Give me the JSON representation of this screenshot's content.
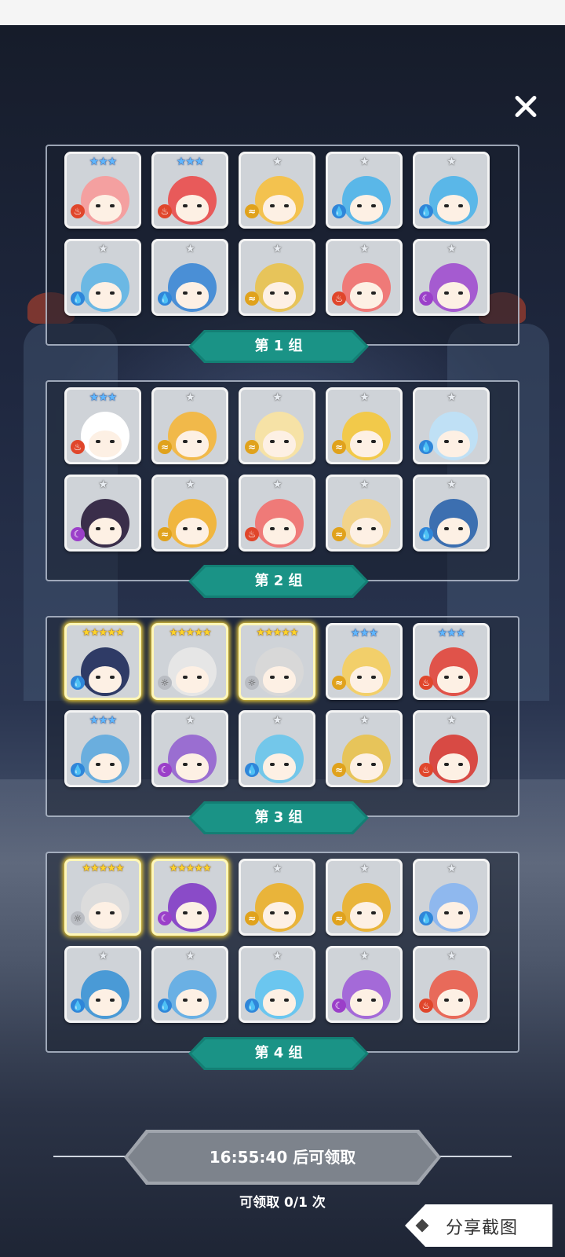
{
  "close_icon": "close-icon",
  "groups": [
    {
      "label": "第 1 组",
      "cards": [
        {
          "stars": "★★★",
          "star_tier": "blue",
          "element": "fire",
          "hair": "#f4a0a0",
          "frame": "normal"
        },
        {
          "stars": "★★★",
          "star_tier": "blue",
          "element": "fire",
          "hair": "#e85a5a",
          "frame": "normal"
        },
        {
          "stars": "★",
          "star_tier": "silver",
          "element": "wind",
          "hair": "#f3c24f",
          "frame": "normal"
        },
        {
          "stars": "★",
          "star_tier": "silver",
          "element": "water",
          "hair": "#5ab7e8",
          "frame": "normal"
        },
        {
          "stars": "★",
          "star_tier": "silver",
          "element": "water",
          "hair": "#5ab7e8",
          "frame": "normal"
        },
        {
          "stars": "★",
          "star_tier": "silver",
          "element": "water",
          "hair": "#6bb8e4",
          "frame": "normal"
        },
        {
          "stars": "★",
          "star_tier": "silver",
          "element": "water",
          "hair": "#4a8fd6",
          "frame": "normal"
        },
        {
          "stars": "★",
          "star_tier": "silver",
          "element": "wind",
          "hair": "#e7c45a",
          "frame": "normal"
        },
        {
          "stars": "★",
          "star_tier": "silver",
          "element": "fire",
          "hair": "#ef7a78",
          "frame": "normal"
        },
        {
          "stars": "★",
          "star_tier": "silver",
          "element": "dark",
          "hair": "#a55bd0",
          "frame": "normal"
        }
      ]
    },
    {
      "label": "第 2 组",
      "cards": [
        {
          "stars": "★★★",
          "star_tier": "blue",
          "element": "fire",
          "hair": "#ffffff",
          "frame": "normal"
        },
        {
          "stars": "★",
          "star_tier": "silver",
          "element": "wind",
          "hair": "#f1b94a",
          "frame": "normal"
        },
        {
          "stars": "★",
          "star_tier": "silver",
          "element": "wind",
          "hair": "#f6e2a6",
          "frame": "normal"
        },
        {
          "stars": "★",
          "star_tier": "silver",
          "element": "wind",
          "hair": "#f2c94a",
          "frame": "normal"
        },
        {
          "stars": "★",
          "star_tier": "silver",
          "element": "water",
          "hair": "#bfe0f5",
          "frame": "normal"
        },
        {
          "stars": "★",
          "star_tier": "silver",
          "element": "dark",
          "hair": "#3a2e4a",
          "frame": "normal"
        },
        {
          "stars": "★",
          "star_tier": "silver",
          "element": "wind",
          "hair": "#f0b640",
          "frame": "normal"
        },
        {
          "stars": "★",
          "star_tier": "silver",
          "element": "fire",
          "hair": "#ef7a78",
          "frame": "normal"
        },
        {
          "stars": "★",
          "star_tier": "silver",
          "element": "wind",
          "hair": "#f2d38a",
          "frame": "normal"
        },
        {
          "stars": "★",
          "star_tier": "silver",
          "element": "water",
          "hair": "#3c6fb0",
          "frame": "normal"
        }
      ]
    },
    {
      "label": "第 3 组",
      "cards": [
        {
          "stars": "★★★★★",
          "star_tier": "gold",
          "element": "water",
          "hair": "#2f3b66",
          "frame": "gold"
        },
        {
          "stars": "★★★★★",
          "star_tier": "gold",
          "element": "light",
          "hair": "#e6e6e6",
          "frame": "gold"
        },
        {
          "stars": "★★★★★",
          "star_tier": "gold",
          "element": "light",
          "hair": "#d8d8d8",
          "frame": "gold"
        },
        {
          "stars": "★★★",
          "star_tier": "blue",
          "element": "wind",
          "hair": "#f2cf6a",
          "frame": "normal"
        },
        {
          "stars": "★★★",
          "star_tier": "blue",
          "element": "fire",
          "hair": "#e0534a",
          "frame": "normal"
        },
        {
          "stars": "★★★",
          "star_tier": "blue",
          "element": "water",
          "hair": "#6aaede",
          "frame": "normal"
        },
        {
          "stars": "★",
          "star_tier": "silver",
          "element": "dark",
          "hair": "#9a6ed1",
          "frame": "normal"
        },
        {
          "stars": "★",
          "star_tier": "silver",
          "element": "water",
          "hair": "#73c7ea",
          "frame": "normal"
        },
        {
          "stars": "★",
          "star_tier": "silver",
          "element": "wind",
          "hair": "#e7c45a",
          "frame": "normal"
        },
        {
          "stars": "★",
          "star_tier": "silver",
          "element": "fire",
          "hair": "#d84a44",
          "frame": "normal"
        }
      ]
    },
    {
      "label": "第 4 组",
      "cards": [
        {
          "stars": "★★★★★",
          "star_tier": "gold",
          "element": "light",
          "hair": "#dcdcdc",
          "frame": "gold"
        },
        {
          "stars": "★★★★★",
          "star_tier": "gold",
          "element": "dark",
          "hair": "#8a4bc8",
          "frame": "gold"
        },
        {
          "stars": "★",
          "star_tier": "silver",
          "element": "wind",
          "hair": "#e9b43a",
          "frame": "normal"
        },
        {
          "stars": "★",
          "star_tier": "silver",
          "element": "wind",
          "hair": "#e9b43a",
          "frame": "normal"
        },
        {
          "stars": "★",
          "star_tier": "silver",
          "element": "water",
          "hair": "#8fb8ee",
          "frame": "normal"
        },
        {
          "stars": "★",
          "star_tier": "silver",
          "element": "water",
          "hair": "#4a9ad6",
          "frame": "normal"
        },
        {
          "stars": "★",
          "star_tier": "silver",
          "element": "water",
          "hair": "#6ab0e4",
          "frame": "normal"
        },
        {
          "stars": "★",
          "star_tier": "silver",
          "element": "water",
          "hair": "#6bc6ef",
          "frame": "normal"
        },
        {
          "stars": "★",
          "star_tier": "silver",
          "element": "dark",
          "hair": "#a46ad8",
          "frame": "normal"
        },
        {
          "stars": "★",
          "star_tier": "silver",
          "element": "fire",
          "hair": "#e86a5a",
          "frame": "normal"
        }
      ]
    }
  ],
  "element_icons": {
    "fire": "fire-icon",
    "water": "water-drop-icon",
    "wind": "wind-icon",
    "dark": "moon-icon",
    "light": "sun-icon"
  },
  "footer": {
    "timer_label": "16:55:40 后可领取",
    "claim_count": "可领取 0/1 次",
    "share_label": "分享截图"
  }
}
